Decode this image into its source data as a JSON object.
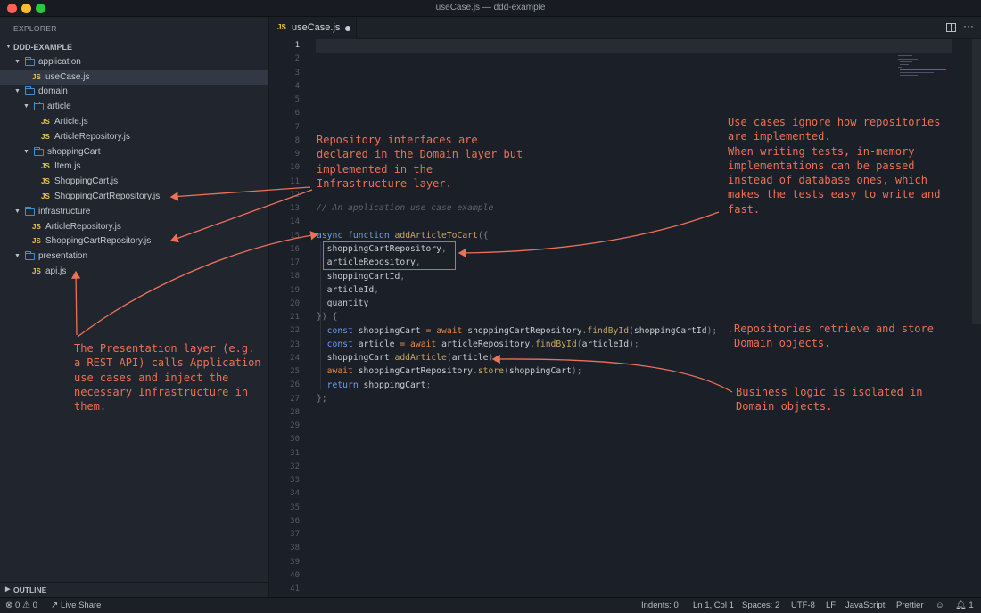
{
  "window": {
    "title": "useCase.js — ddd-example"
  },
  "sidebar": {
    "title": "EXPLORER",
    "root_label": "DDD-EXAMPLE",
    "tree": [
      {
        "label": "application",
        "kind": "folder",
        "depth": 1,
        "expanded": true
      },
      {
        "label": "useCase.js",
        "kind": "file",
        "depth": 2,
        "selected": true
      },
      {
        "label": "domain",
        "kind": "folder",
        "depth": 1,
        "expanded": true
      },
      {
        "label": "article",
        "kind": "folder",
        "depth": 2,
        "expanded": true
      },
      {
        "label": "Article.js",
        "kind": "file",
        "depth": 3
      },
      {
        "label": "ArticleRepository.js",
        "kind": "file",
        "depth": 3
      },
      {
        "label": "shoppingCart",
        "kind": "folder",
        "depth": 2,
        "expanded": true
      },
      {
        "label": "Item.js",
        "kind": "file",
        "depth": 3
      },
      {
        "label": "ShoppingCart.js",
        "kind": "file",
        "depth": 3
      },
      {
        "label": "ShoppingCartRepository.js",
        "kind": "file",
        "depth": 3
      },
      {
        "label": "infrastructure",
        "kind": "folder",
        "depth": 1,
        "expanded": true
      },
      {
        "label": "ArticleRepository.js",
        "kind": "file",
        "depth": 2
      },
      {
        "label": "ShoppingCartRepository.js",
        "kind": "file",
        "depth": 2
      },
      {
        "label": "presentation",
        "kind": "folder",
        "depth": 1,
        "expanded": true
      },
      {
        "label": "api.js",
        "kind": "file",
        "depth": 2
      }
    ],
    "outline_label": "OUTLINE",
    "js_badge": "JS"
  },
  "tab": {
    "label": "useCase.js",
    "js_badge": "JS",
    "modified": true
  },
  "editor": {
    "line_numbers": [
      "1",
      "2",
      "3",
      "4",
      "5",
      "6",
      "7",
      "8",
      "9",
      "10",
      "11",
      "12",
      "13",
      "14",
      "15",
      "16",
      "17",
      "18",
      "19",
      "20",
      "21",
      "22",
      "23",
      "24",
      "25",
      "26",
      "27",
      "28",
      "29",
      "30",
      "31",
      "32",
      "33",
      "34",
      "35",
      "36",
      "37",
      "38",
      "39",
      "40",
      "41"
    ],
    "current_line": "1",
    "code": {
      "l13": "// An application use case example",
      "l15_kw1": "async",
      "l15_kw2": "function",
      "l15_fn": "addArticleToCart",
      "l15_rest": "({",
      "l16": "shoppingCartRepository",
      "l17": "articleRepository",
      "l18": "shoppingCartId",
      "l19": "articleId",
      "l20": "quantity",
      "l21": "}) {",
      "l22_kw": "const",
      "l22_var": "shoppingCart",
      "l22_eq": "=",
      "l22_await": "await",
      "l22_obj": "shoppingCartRepository",
      "l22_method": "findById",
      "l22_arg": "shoppingCartId",
      "l23_kw": "const",
      "l23_var": "article",
      "l23_eq": "=",
      "l23_await": "await",
      "l23_obj": "articleRepository",
      "l23_method": "findById",
      "l23_arg": "articleId",
      "l24_obj": "shoppingCart",
      "l24_method": "addArticle",
      "l24_arg": "article",
      "l25_await": "await",
      "l25_obj": "shoppingCartRepository",
      "l25_method": "store",
      "l25_arg": "shoppingCart",
      "l26_kw": "return",
      "l26_var": "shoppingCart",
      "l27": "};"
    }
  },
  "annotations": {
    "repo_interfaces": "Repository interfaces are\ndeclared in the Domain layer but\nimplemented in the\nInfrastructure layer.",
    "use_cases": "Use cases ignore how repositories\nare implemented.\nWhen writing tests, in-memory\nimplementations can be passed\ninstead of database ones, which\nmakes the tests easy to write and\nfast.",
    "repositories": "Repositories retrieve and store\nDomain objects.",
    "business_logic": "Business logic is isolated in\nDomain objects.",
    "presentation": "The Presentation layer (e.g.\na REST API) calls Application\nuse cases and inject the\nnecessary Infrastructure in\nthem.",
    "color": "#ec7158"
  },
  "statusbar": {
    "errors": "0",
    "warnings": "0",
    "live_share": "Live Share",
    "indents": "Indents: 0",
    "cursor": "Ln 1, Col 1",
    "spaces": "Spaces: 2",
    "encoding": "UTF-8",
    "eol": "LF",
    "language": "JavaScript",
    "formatter": "Prettier",
    "notifications": "1"
  }
}
